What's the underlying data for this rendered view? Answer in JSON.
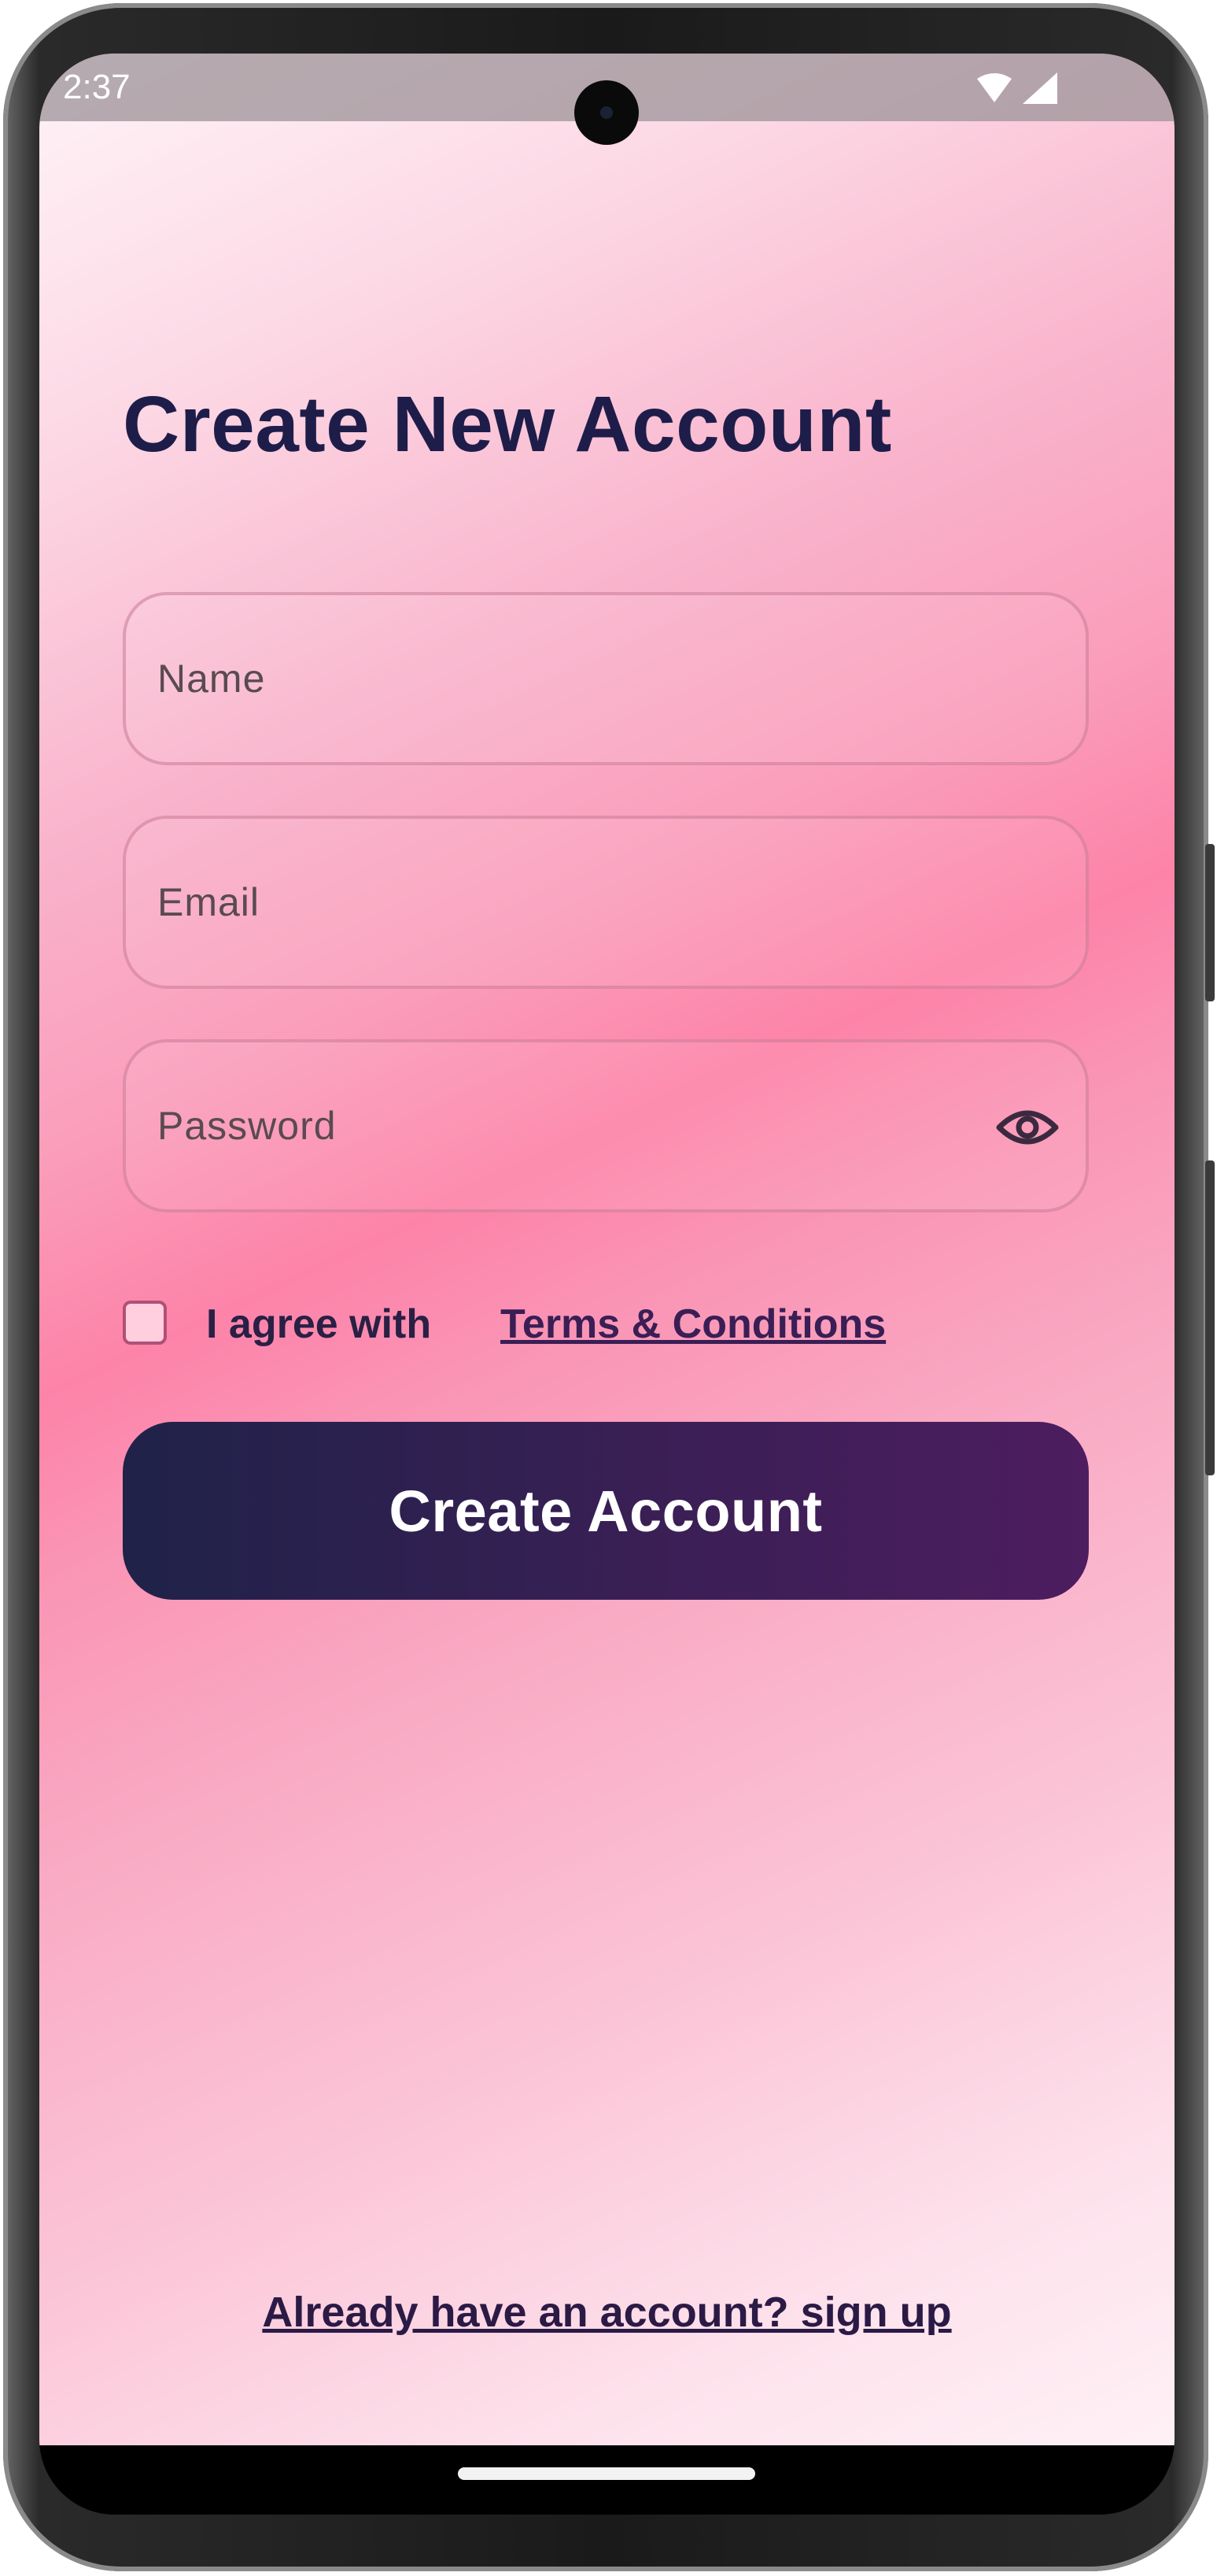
{
  "status_bar": {
    "time": "2:37",
    "icons": [
      "wifi-icon",
      "signal-icon"
    ]
  },
  "screen": {
    "title": "Create New Account"
  },
  "form": {
    "name_placeholder": "Name",
    "email_placeholder": "Email",
    "password_placeholder": "Password",
    "password_toggle_icon": "eye-icon",
    "agree_label": "I agree with",
    "terms_link": "Terms & Conditions",
    "agree_checked": false,
    "submit_label": "Create Account"
  },
  "footer": {
    "signin_link": "Already have an account? sign up"
  },
  "colors": {
    "title": "#1e1d4a",
    "button_start": "#1f2249",
    "button_end": "#4d1d5f",
    "background_accent": "#fd83a9"
  }
}
